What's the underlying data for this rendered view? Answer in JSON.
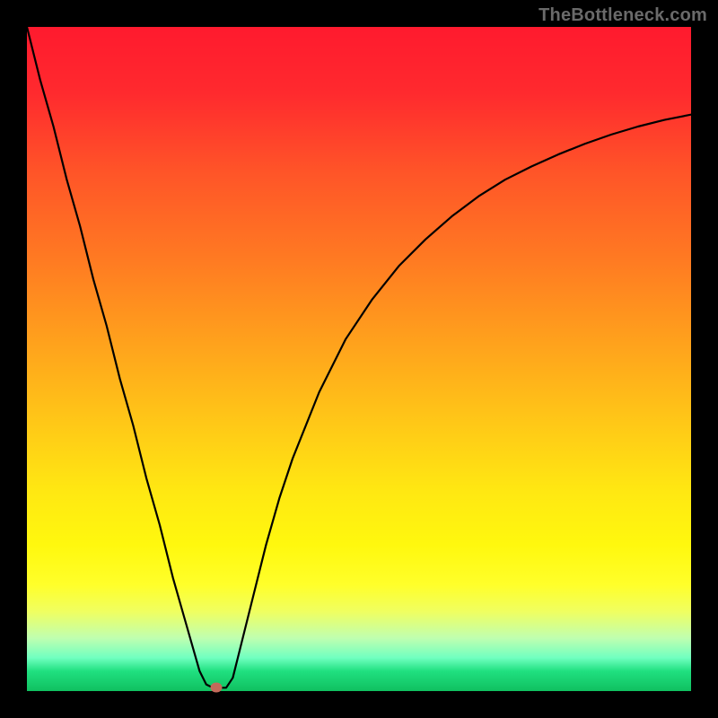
{
  "attribution": "TheBottleneck.com",
  "colors": {
    "background": "#000000",
    "gradient_top": "#ff1a2e",
    "gradient_bottom": "#10c060",
    "curve": "#000000",
    "marker": "#c46a5a"
  },
  "chart_data": {
    "type": "line",
    "title": "",
    "xlabel": "",
    "ylabel": "",
    "xlim": [
      0,
      100
    ],
    "ylim": [
      0,
      100
    ],
    "x": [
      0,
      2,
      4,
      6,
      8,
      10,
      12,
      14,
      16,
      18,
      20,
      22,
      24,
      26,
      27,
      28,
      29,
      30,
      31,
      32,
      34,
      36,
      38,
      40,
      44,
      48,
      52,
      56,
      60,
      64,
      68,
      72,
      76,
      80,
      84,
      88,
      92,
      96,
      100
    ],
    "values": [
      100,
      92,
      85,
      77,
      70,
      62,
      55,
      47,
      40,
      32,
      25,
      17,
      10,
      3,
      1,
      0.5,
      0.5,
      0.5,
      2,
      6,
      14,
      22,
      29,
      35,
      45,
      53,
      59,
      64,
      68,
      71.5,
      74.5,
      77,
      79,
      80.8,
      82.4,
      83.8,
      85,
      86,
      86.8
    ],
    "annotations": [
      {
        "type": "marker",
        "x": 28.5,
        "y": 0.5,
        "shape": "oval",
        "color": "#c46a5a"
      }
    ]
  }
}
